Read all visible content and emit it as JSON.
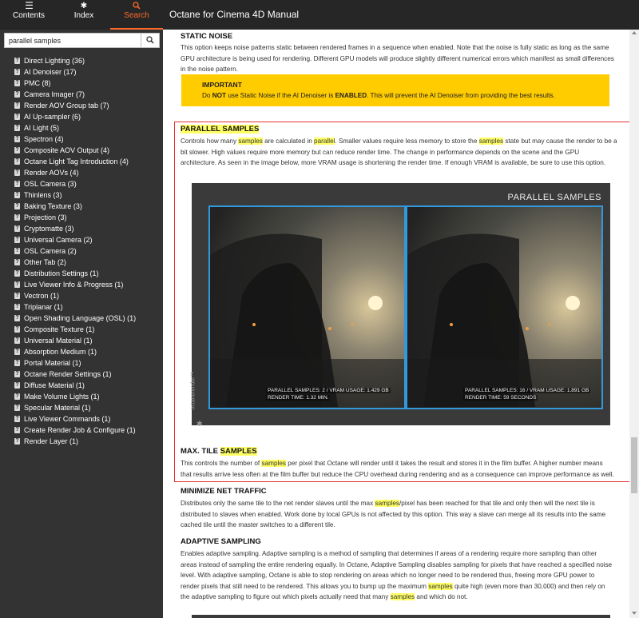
{
  "sidebar": {
    "tabs": [
      {
        "label": "Contents",
        "icon": "list-icon"
      },
      {
        "label": "Index",
        "icon": "asterisk-icon"
      },
      {
        "label": "Search",
        "icon": "search-icon",
        "active": true
      }
    ],
    "search": {
      "value": "parallel samples",
      "placeholder": ""
    },
    "results": [
      "Direct Lighting (36)",
      "AI Denoiser (17)",
      "PMC (8)",
      "Camera Imager (7)",
      "Render AOV Group tab (7)",
      "AI Up-sampler (6)",
      "AI Light (5)",
      "Spectron (4)",
      "Composite AOV Output (4)",
      "Octane Light Tag Introduction (4)",
      "Render AOVs (4)",
      "OSL Camera (3)",
      "Thinlens (3)",
      "Baking Texture (3)",
      "Projection (3)",
      "Cryptomatte (3)",
      "Universal Camera (2)",
      "OSL Camera (2)",
      "Other Tab (2)",
      "Distribution Settings (1)",
      "Live Viewer Info & Progress (1)",
      "Vectron (1)",
      "Triplanar (1)",
      "Open Shading Language (OSL) (1)",
      "Composite Texture (1)",
      "Universal Material (1)",
      "Absorption Medium (1)",
      "Portal Material (1)",
      "Octane Render Settings (1)",
      "Diffuse Material (1)",
      "Make Volume Lights (1)",
      "Specular Material (1)",
      "Live Viewer Commands (1)",
      "Create Render Job & Configure (1)",
      "Render Layer (1)"
    ]
  },
  "header": {
    "title": "Octane for Cinema 4D Manual"
  },
  "content": {
    "static_noise": {
      "heading": "STATIC NOISE",
      "l1": "This option keeps noise patterns static between rendered frames in a sequence when enabled. Note that the noise is fully static as long as the same",
      "l2": "GPU architecture is being used for rendering. Different GPU models will produce slightly different numerical errors which manifest as small differences",
      "l3": "in the noise pattern."
    },
    "important": {
      "title": "IMPORTANT",
      "pre": "Do ",
      "not": "NOT",
      "mid": " use Static Noise if the AI Denoiser is ",
      "enabled": "ENABLED",
      "post": ". This will prevent the AI Denoiser from providing the best results."
    },
    "parallel": {
      "heading": "PARALLEL SAMPLES",
      "l1a": "Controls how many ",
      "l1b": "samples",
      "l1c": " are calculated in ",
      "l1d": "parallel",
      "l1e": ". Smaller values require less memory to store the ",
      "l1f": "samples",
      "l1g": " state but may cause the render to be a",
      "l2": "bit slower. High values require more memory but can reduce render time. The change in performance depends on the scene and the GPU",
      "l3": "architecture. As seen in the image below, more VRAM usage is shortening the render time. If enough VRAM is available, be sure to use this option."
    },
    "render": {
      "title": "PARALLEL SAMPLES",
      "left_cap1": "PARALLEL SAMPLES: 2 / VRAM USAGE: 1.429 GB",
      "left_cap2": "RENDER TIME: 1.32 MIN.",
      "right_cap1": "PARALLEL SAMPLES: 16 / VRAM USAGE: 1.891 GB",
      "right_cap2": "RENDER TIME: 59 SECONDS",
      "brand": "octanerender™"
    },
    "max_tile": {
      "heading_a": "MAX. TILE ",
      "heading_b": "SAMPLES",
      "l1a": "This controls the number of ",
      "l1b": "samples",
      "l1c": " per pixel that Octane will render until it takes the result and stores it in the film buffer. A higher number means",
      "l2": "that results arrive less often at the film buffer but reduce the CPU overhead during rendering and as a consequence can improve performance as well."
    },
    "minimize": {
      "heading": "MINIMIZE NET TRAFFIC",
      "l1a": "Distributes only the same tile to the net render slaves until the max ",
      "l1b": "samples",
      "l1c": "/pixel has been reached for that tile and only then will the next tile is",
      "l2": "distributed to slaves when enabled. Work done by local GPUs is not affected by this option. This way a slave can merge all its results into the same",
      "l3": "cached tile until the master switches to a different tile."
    },
    "adaptive": {
      "heading": "ADAPTIVE SAMPLING",
      "l1": "Enables adaptive sampling. Adaptive sampling is a method of sampling that determines if areas of a rendering require more sampling than other",
      "l2": "areas instead of sampling the entire rendering equally. In Octane, Adaptive Sampling disables sampling for pixels that have reached a specified noise",
      "l3": "level. With adaptive sampling, Octane is able to stop rendering on areas which no longer need to be rendered thus, freeing more GPU power to",
      "l4a": "render pixels that still need to be rendered. This allows you to bump up the maximum ",
      "l4b": "samples",
      "l4c": " quite high (even more than 30,000) and then rely on",
      "l5a": "the adaptive sampling to figure out which pixels actually need that many ",
      "l5b": "samples",
      "l5c": " and which do not."
    }
  },
  "colors": {
    "accent": "#ff6a2a",
    "highlight": "#ffff66",
    "important_bg": "#ffcc00",
    "frame": "#e53333",
    "panel_border": "#3399dd"
  }
}
